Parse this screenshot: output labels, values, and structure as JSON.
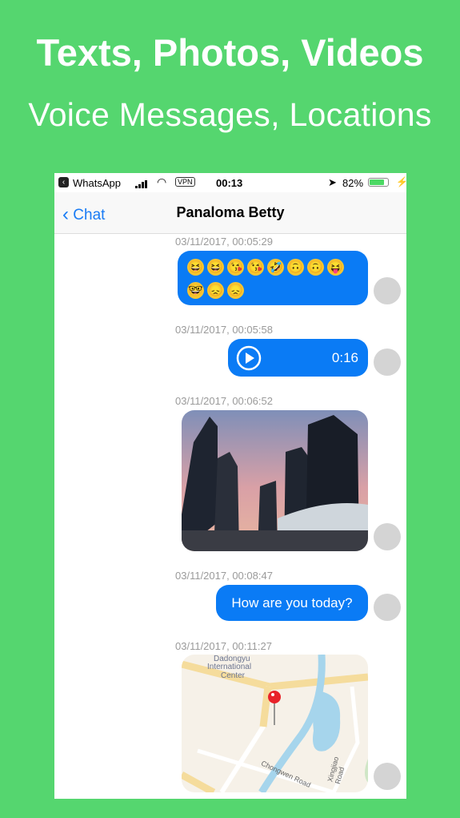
{
  "headline": {
    "line1": "Texts, Photos, Videos",
    "line2": "Voice Messages, Locations"
  },
  "status_bar": {
    "app": "WhatsApp",
    "vpn": "VPN",
    "time": "00:13",
    "battery": "82%",
    "battery_level": 0.82
  },
  "nav": {
    "back_label": "Chat",
    "title": "Panaloma Betty"
  },
  "messages": [
    {
      "timestamp": "03/11/2017, 00:05:29",
      "type": "emoji",
      "emojis": [
        "😆",
        "😆",
        "😘",
        "😘",
        "🤣",
        "🙃",
        "🙃",
        "😝",
        "🤓",
        "😞",
        "😞"
      ]
    },
    {
      "timestamp": "03/11/2017, 00:05:58",
      "type": "voice",
      "duration": "0:16"
    },
    {
      "timestamp": "03/11/2017, 00:06:52",
      "type": "photo"
    },
    {
      "timestamp": "03/11/2017, 00:08:47",
      "type": "text",
      "text": "How are you today?"
    },
    {
      "timestamp": "03/11/2017, 00:11:27",
      "type": "location",
      "map_labels": [
        "Dadongyu",
        "International",
        "Center",
        "Chongwen Road",
        "Xingjiao Road"
      ]
    }
  ],
  "colors": {
    "background": "#55d66f",
    "bubble": "#0a7bf5",
    "accent": "#1a7cf5"
  }
}
